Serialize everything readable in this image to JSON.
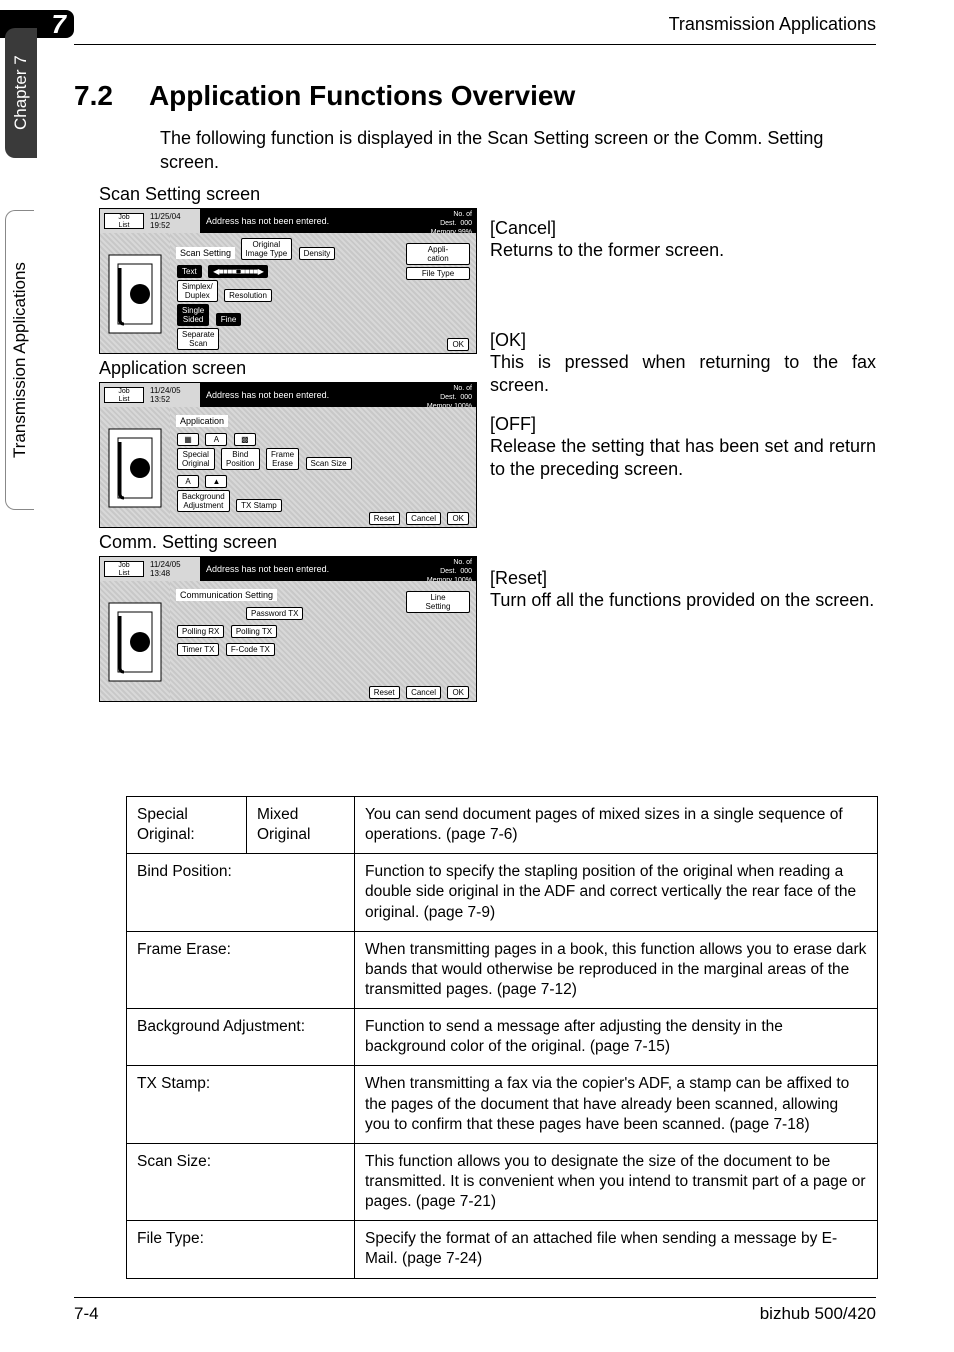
{
  "header": {
    "chapter_number": "7",
    "running_title": "Transmission Applications"
  },
  "side_tabs": {
    "chapter": "Chapter 7",
    "section": "Transmission Applications"
  },
  "section": {
    "number": "7.2",
    "title": "Application Functions Overview",
    "intro": "The following function is displayed in the Scan Setting screen or the Comm. Setting screen."
  },
  "labels": {
    "scan_setting_screen": "Scan Setting screen",
    "application_screen": "Application screen",
    "comm_setting_screen": "Comm. Setting screen"
  },
  "right_side": {
    "cancel_h": "[Cancel]",
    "cancel_p": "Returns to the former screen.",
    "ok_h": "[OK]",
    "ok_p": "This is pressed when returning to the fax screen.",
    "off_h": "[OFF]",
    "off_p": "Release the setting that has been set and return to the preceding screen.",
    "reset_h": "[Reset]",
    "reset_p": "Turn off all the functions provided on the screen."
  },
  "screens": {
    "job_list": "Job\nList",
    "msg": "Address has not been entered.",
    "dest_label": "No. of\nDest.",
    "dest_val": "000",
    "scan": {
      "date": "11/25/04",
      "time": "19:52",
      "memory": "Memory  99%",
      "title": "Scan Setting",
      "btns": {
        "orig": "Original\nImage Type",
        "text": "Text",
        "density": "Density",
        "simplex": "Simplex/\nDuplex",
        "single": "Single\nSided",
        "resolution": "Resolution",
        "fine": "Fine",
        "separate": "Separate\nScan",
        "appli": "Appli-\ncation",
        "filetype": "File Type",
        "ok": "OK"
      }
    },
    "app": {
      "date": "11/24/05",
      "time": "13:52",
      "memory": "Memory 100%",
      "title": "Application",
      "btns": {
        "special": "Special\nOriginal",
        "bind": "Bind\nPosition",
        "frame": "Frame\nErase",
        "scansize": "Scan Size",
        "bg": "Background\nAdjustment",
        "txstamp": "TX Stamp",
        "reset": "Reset",
        "cancel": "Cancel",
        "ok": "OK"
      }
    },
    "comm": {
      "date": "11/24/05",
      "time": "13:48",
      "memory": "Memory 100%",
      "title": "Communication Setting",
      "btns": {
        "password": "Password TX",
        "line": "Line\nSetting",
        "pollingrx": "Polling RX",
        "pollingtx": "Polling TX",
        "timer": "Timer TX",
        "fcode": "F-Code TX",
        "reset": "Reset",
        "cancel": "Cancel",
        "ok": "OK"
      }
    }
  },
  "table": {
    "r1c1": "Special Original:",
    "r1c2": "Mixed Original",
    "r1c3": "You can send document pages of mixed sizes in a single sequence of operations. (page 7-6)",
    "r2c1": "Bind Position:",
    "r2c3": "Function to specify the stapling position of the original when reading a double side original in the ADF and correct vertically the rear face of the original. (page 7-9)",
    "r3c1": "Frame Erase:",
    "r3c3": "When transmitting pages in a book, this function allows you to erase dark bands that would otherwise be reproduced in the marginal areas of the transmitted pages. (page 7-12)",
    "r4c1": "Background Adjustment:",
    "r4c3": "Function to send a message after adjusting the density in the background color of the original. (page 7-15)",
    "r5c1": "TX Stamp:",
    "r5c3": "When transmitting a fax via the copier's ADF, a stamp can be affixed to the pages of the document that have already been scanned, allowing you to confirm that these pages have been scanned. (page 7-18)",
    "r6c1": "Scan Size:",
    "r6c3": "This function allows you to designate the size of the document to be transmitted. It is convenient when you intend to transmit part of a page or pages. (page 7-21)",
    "r7c1": "File Type:",
    "r7c3": "Specify the format of an attached file when sending a message by E-Mail. (page 7-24)"
  },
  "footer": {
    "left": "7-4",
    "right": "bizhub 500/420"
  }
}
